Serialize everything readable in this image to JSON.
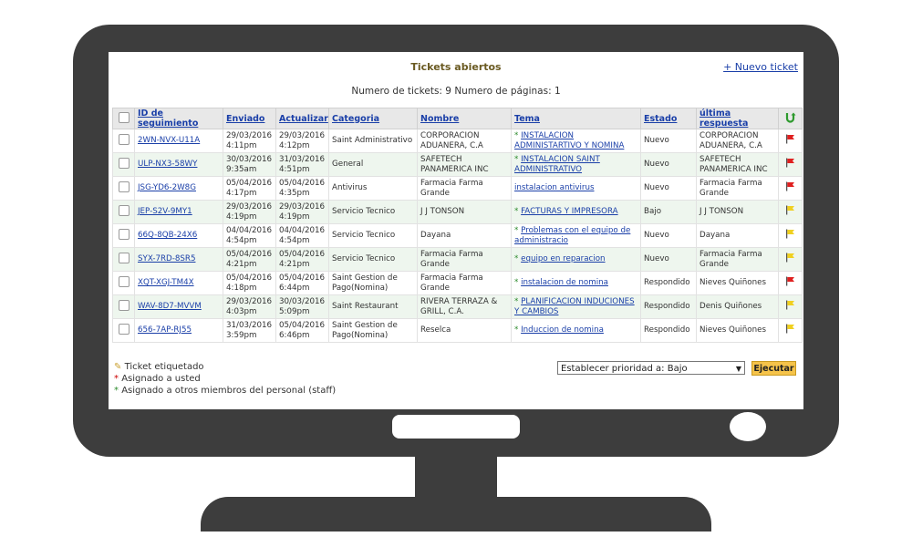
{
  "header": {
    "title": "Tickets abiertos",
    "new_ticket_label": "+ Nuevo ticket",
    "counts": "Numero de tickets: 9 Numero de páginas: 1"
  },
  "table": {
    "columns": [
      "ID de seguimiento",
      "Enviado",
      "Actualizar",
      "Categoria",
      "Nombre",
      "Tema",
      "Estado",
      "última respuesta"
    ],
    "rows": [
      {
        "id": "2WN-NVX-U11A",
        "sent_date": "29/03/2016",
        "sent_time": "4:11pm",
        "upd_date": "29/03/2016",
        "upd_time": "4:12pm",
        "category": "Saint Administrativo",
        "name": "CORPORACION ADUANERA, C.A",
        "topic": "INSTALACION ADMINISTARTIVO Y NOMINA",
        "star": "*",
        "status": "Nuevo",
        "last": "CORPORACION ADUANERA, C.A",
        "flag": "red"
      },
      {
        "id": "ULP-NX3-58WY",
        "sent_date": "30/03/2016",
        "sent_time": "9:35am",
        "upd_date": "31/03/2016",
        "upd_time": "4:51pm",
        "category": "General",
        "name": "SAFETECH PANAMERICA INC",
        "topic": "INSTALACION SAINT ADMINISTRATIVO",
        "star": "*",
        "status": "Nuevo",
        "last": "SAFETECH PANAMERICA INC",
        "flag": "red"
      },
      {
        "id": "JSG-YD6-2W8G",
        "sent_date": "05/04/2016",
        "sent_time": "4:17pm",
        "upd_date": "05/04/2016",
        "upd_time": "4:35pm",
        "category": "Antivirus",
        "name": "Farmacia Farma Grande",
        "topic": "instalacion antivirus",
        "star": "",
        "status": "Nuevo",
        "last": "Farmacia Farma Grande",
        "flag": "red"
      },
      {
        "id": "JEP-S2V-9MY1",
        "sent_date": "29/03/2016",
        "sent_time": "4:19pm",
        "upd_date": "29/03/2016",
        "upd_time": "4:19pm",
        "category": "Servicio Tecnico",
        "name": "J J TONSON",
        "topic": "FACTURAS Y IMPRESORA",
        "star": "*",
        "status": "Bajo",
        "last": "J J TONSON",
        "flag": "yellow"
      },
      {
        "id": "66Q-8QB-24X6",
        "sent_date": "04/04/2016",
        "sent_time": "4:54pm",
        "upd_date": "04/04/2016",
        "upd_time": "4:54pm",
        "category": "Servicio Tecnico",
        "name": "Dayana",
        "topic": "Problemas con el equipo de administracio",
        "star": "*",
        "status": "Nuevo",
        "last": "Dayana",
        "flag": "yellow"
      },
      {
        "id": "SYX-7RD-8SR5",
        "sent_date": "05/04/2016",
        "sent_time": "4:21pm",
        "upd_date": "05/04/2016",
        "upd_time": "4:21pm",
        "category": "Servicio Tecnico",
        "name": "Farmacia Farma Grande",
        "topic": "equipo en reparacion",
        "star": "*",
        "status": "Nuevo",
        "last": "Farmacia Farma Grande",
        "flag": "yellow"
      },
      {
        "id": "XQT-XGJ-TM4X",
        "sent_date": "05/04/2016",
        "sent_time": "4:18pm",
        "upd_date": "05/04/2016",
        "upd_time": "6:44pm",
        "category": "Saint Gestion de Pago(Nomina)",
        "name": "Farmacia Farma Grande",
        "topic": "instalacion de nomina",
        "star": "*",
        "status": "Respondido",
        "last": "Nieves Quiñones",
        "flag": "red"
      },
      {
        "id": "WAV-8D7-MVVM",
        "sent_date": "29/03/2016",
        "sent_time": "4:03pm",
        "upd_date": "30/03/2016",
        "upd_time": "5:09pm",
        "category": "Saint Restaurant",
        "name": "RIVERA TERRAZA & GRILL, C.A.",
        "topic": "PLANIFICACION INDUCIONES Y CAMBIOS",
        "star": "*",
        "status": "Respondido",
        "last": "Denis Quiñones",
        "flag": "yellow"
      },
      {
        "id": "656-7AP-RJ55",
        "sent_date": "31/03/2016",
        "sent_time": "3:59pm",
        "upd_date": "05/04/2016",
        "upd_time": "6:46pm",
        "category": "Saint Gestion de Pago(Nomina)",
        "name": "Reselca",
        "topic": "Induccion de nomina",
        "star": "*",
        "status": "Respondido",
        "last": "Nieves Quiñones",
        "flag": "yellow"
      }
    ]
  },
  "legend": {
    "tagged": "Ticket etiquetado",
    "assigned_you_mark": "*",
    "assigned_you": "Asignado a usted",
    "assigned_others_mark": "*",
    "assigned_others": "Asignado a otros miembros del personal (staff)"
  },
  "actions": {
    "priority_select_value": "Establecer prioridad a: Bajo",
    "execute_label": "Ejecutar"
  },
  "colors": {
    "bezel": "#3d3d3d",
    "status_new": "#cc0000",
    "status_responded": "#1a3fa8",
    "flag_red": "#e02020",
    "flag_yellow": "#f0d020"
  }
}
